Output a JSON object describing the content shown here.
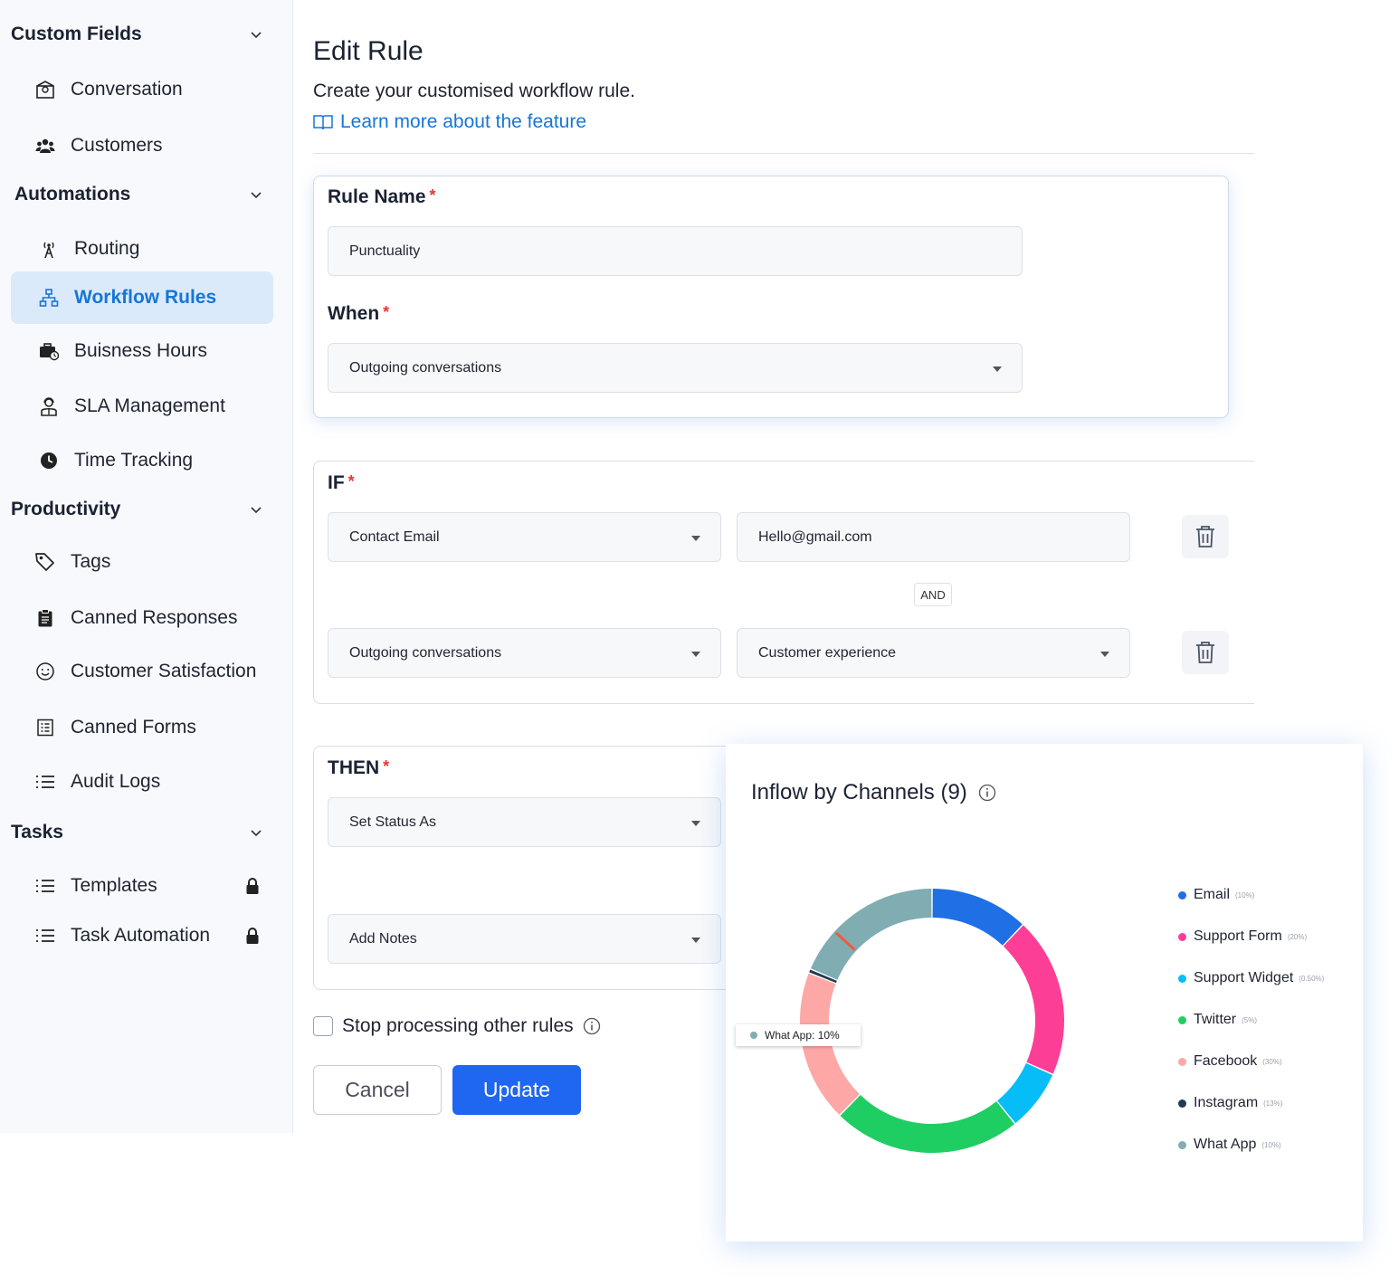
{
  "sidebar": {
    "sections": {
      "custom_fields": "Custom Fields",
      "automations": "Automations",
      "productivity": "Productivity",
      "tasks": "Tasks"
    },
    "items": {
      "conversation": "Conversation",
      "customers": "Customers",
      "routing": "Routing",
      "workflow_rules": "Workflow Rules",
      "business_hours": "Buisness Hours",
      "sla_management": "SLA Management",
      "time_tracking": "Time Tracking",
      "tags": "Tags",
      "canned_responses": "Canned Responses",
      "customer_satisfaction": "Customer Satisfaction",
      "canned_forms": "Canned Forms",
      "audit_logs": "Audit Logs",
      "templates": "Templates",
      "task_automation": "Task Automation"
    }
  },
  "main": {
    "title": "Edit Rule",
    "subtitle": "Create your customised workflow rule.",
    "learn_more": "Learn more about the feature",
    "rule_name_label": "Rule Name",
    "rule_name_value": "Punctuality",
    "when_label": "When",
    "when_value": "Outgoing conversations",
    "if_label": "IF",
    "if_rows": [
      {
        "field": "Contact Email",
        "value": "Hello@gmail.com"
      },
      {
        "field": "Outgoing conversations",
        "value": "Customer experience"
      }
    ],
    "and_label": "AND",
    "then_label": "THEN",
    "then_rows": [
      "Set Status As",
      "Add Notes"
    ],
    "required_mark": "*",
    "stop_processing": "Stop processing other rules",
    "cancel": "Cancel",
    "update": "Update"
  },
  "chart_data": {
    "type": "pie",
    "title": "Inflow by Channels (9)",
    "categories": [
      "Email",
      "Support Form",
      "Support Widget",
      "Twitter",
      "Facebook",
      "Instagram",
      "What App"
    ],
    "legend_pct_labels": [
      "(10%)",
      "(20%)",
      "(0.50%)",
      "(5%)",
      "(30%)",
      "(13%)",
      "(10%)"
    ],
    "values": [
      12,
      19.5,
      7.5,
      23,
      18.5,
      0.5,
      18.5
    ],
    "colors": [
      "#1f6fe5",
      "#fd3e96",
      "#07bdf8",
      "#1fce62",
      "#fda8a6",
      "#1f3b52",
      "#7fadb2"
    ],
    "highlight_label": "What App: 10%",
    "legend_position": "right"
  }
}
